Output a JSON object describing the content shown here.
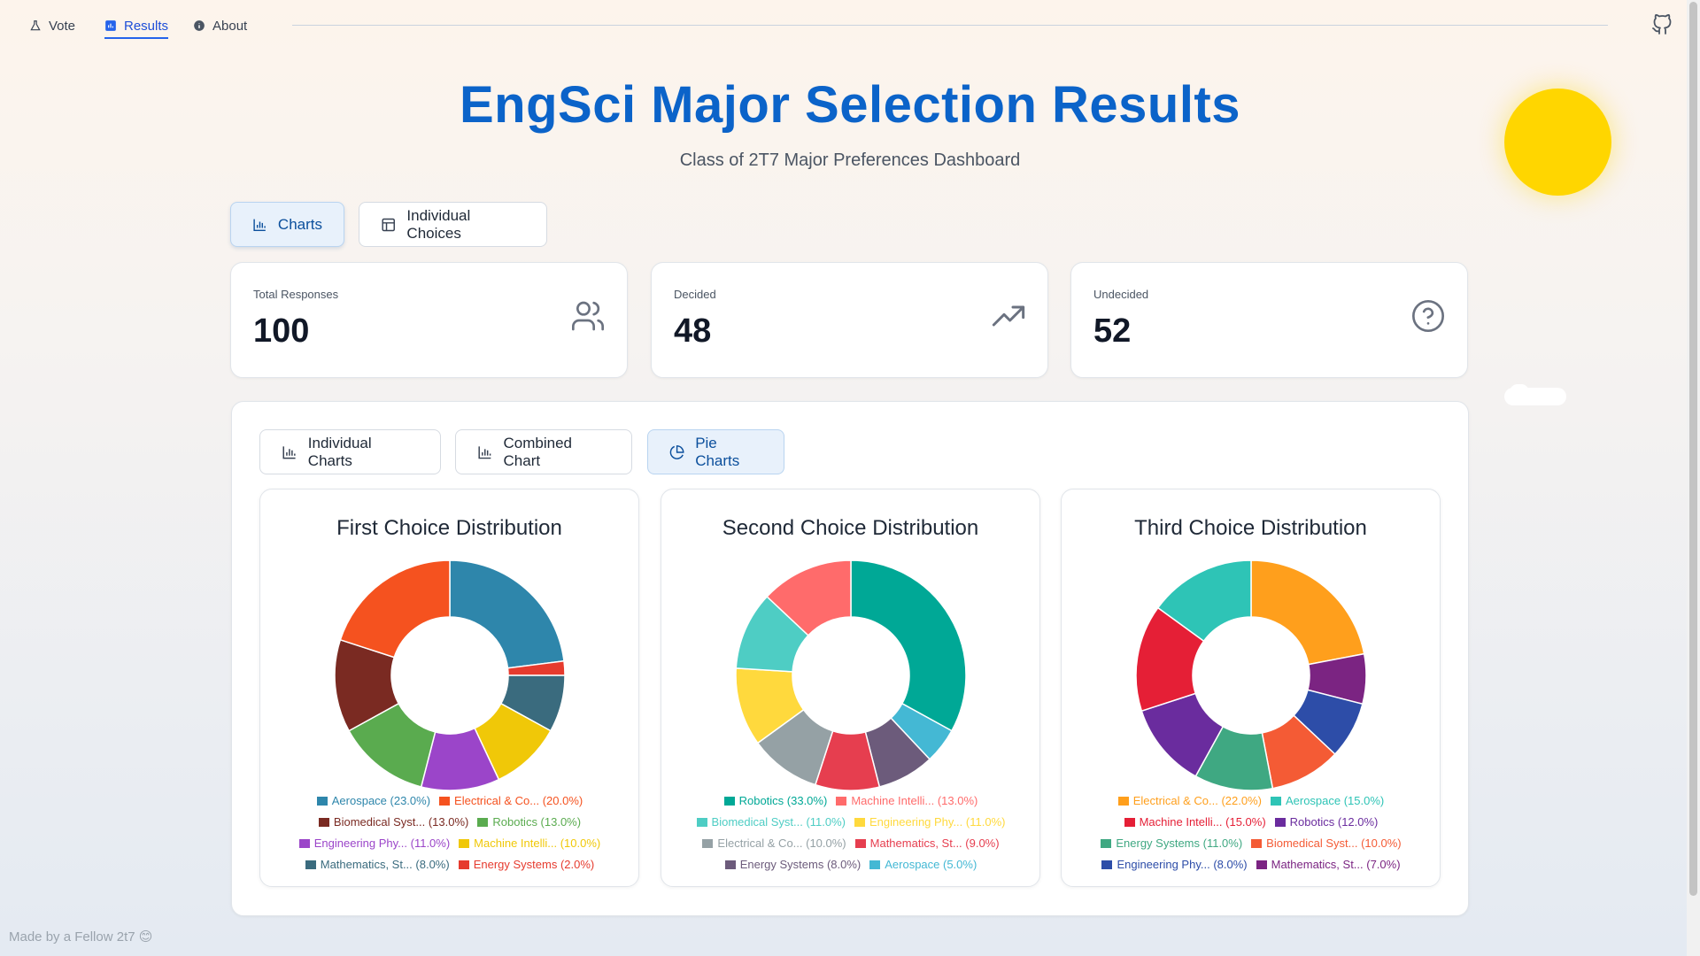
{
  "nav": {
    "items": [
      {
        "label": "Vote",
        "icon": "flask-icon"
      },
      {
        "label": "Results",
        "icon": "bar-chart-icon"
      },
      {
        "label": "About",
        "icon": "info-icon"
      }
    ],
    "github_icon": "github-icon"
  },
  "header": {
    "title": "EngSci Major Selection Results",
    "subtitle": "Class of 2T7 Major Preferences Dashboard"
  },
  "view_tabs": [
    {
      "label": "Charts",
      "icon": "bar-chart-icon",
      "active": true
    },
    {
      "label": "Individual Choices",
      "icon": "table-icon",
      "active": false
    }
  ],
  "stats": [
    {
      "label": "Total Responses",
      "value": "100",
      "icon": "users-icon"
    },
    {
      "label": "Decided",
      "value": "48",
      "icon": "trending-up-icon"
    },
    {
      "label": "Undecided",
      "value": "52",
      "icon": "help-circle-icon"
    }
  ],
  "chart_tabs": [
    {
      "label": "Individual Charts",
      "icon": "bar-chart-icon",
      "active": false
    },
    {
      "label": "Combined Chart",
      "icon": "bar-chart-icon",
      "active": false
    },
    {
      "label": "Pie Charts",
      "icon": "pie-chart-icon",
      "active": true
    }
  ],
  "chart_data": [
    {
      "type": "pie",
      "donut": true,
      "title": "First Choice Distribution",
      "slices": [
        {
          "label": "Aerospace (23.0%)",
          "value": 23,
          "color": "#2e86ab"
        },
        {
          "label": "Energy Systems (2.0%)",
          "value": 2,
          "color": "#e63b2e"
        },
        {
          "label": "Mathematics, St... (8.0%)",
          "value": 8,
          "color": "#3a6b7e"
        },
        {
          "label": "Machine Intelli... (10.0%)",
          "value": 10,
          "color": "#f0c808"
        },
        {
          "label": "Engineering Phy... (11.0%)",
          "value": 11,
          "color": "#9b45c9"
        },
        {
          "label": "Robotics (13.0%)",
          "value": 13,
          "color": "#5aab4f"
        },
        {
          "label": "Biomedical Syst... (13.0%)",
          "value": 13,
          "color": "#7a2a22"
        },
        {
          "label": "Electrical & Co... (20.0%)",
          "value": 20,
          "color": "#f5521f"
        }
      ],
      "legend_order": [
        0,
        7,
        6,
        5,
        4,
        3,
        2,
        1
      ]
    },
    {
      "type": "pie",
      "donut": true,
      "title": "Second Choice Distribution",
      "slices": [
        {
          "label": "Robotics (33.0%)",
          "value": 33,
          "color": "#00a896"
        },
        {
          "label": "Aerospace (5.0%)",
          "value": 5,
          "color": "#44b8d4"
        },
        {
          "label": "Energy Systems (8.0%)",
          "value": 8,
          "color": "#6c5b7b"
        },
        {
          "label": "Mathematics, St... (9.0%)",
          "value": 9,
          "color": "#e63e4f"
        },
        {
          "label": "Electrical & Co... (10.0%)",
          "value": 10,
          "color": "#95a1a5"
        },
        {
          "label": "Engineering Phy... (11.0%)",
          "value": 11,
          "color": "#ffd93d"
        },
        {
          "label": "Biomedical Syst... (11.0%)",
          "value": 11,
          "color": "#4ecdc4"
        },
        {
          "label": "Machine Intelli... (13.0%)",
          "value": 13,
          "color": "#ff6b6b"
        }
      ],
      "legend_order": [
        0,
        7,
        6,
        5,
        4,
        3,
        2,
        1
      ]
    },
    {
      "type": "pie",
      "donut": true,
      "title": "Third Choice Distribution",
      "slices": [
        {
          "label": "Electrical & Co... (22.0%)",
          "value": 22,
          "color": "#ff9f1c"
        },
        {
          "label": "Mathematics, St... (7.0%)",
          "value": 7,
          "color": "#7b2482"
        },
        {
          "label": "Engineering Phy... (8.0%)",
          "value": 8,
          "color": "#2d4da8"
        },
        {
          "label": "Biomedical Syst... (10.0%)",
          "value": 10,
          "color": "#f45b35"
        },
        {
          "label": "Energy Systems (11.0%)",
          "value": 11,
          "color": "#3fa882"
        },
        {
          "label": "Robotics (12.0%)",
          "value": 12,
          "color": "#6a2c9e"
        },
        {
          "label": "Machine Intelli... (15.0%)",
          "value": 15,
          "color": "#e51f36"
        },
        {
          "label": "Aerospace (15.0%)",
          "value": 15,
          "color": "#2ec4b6"
        }
      ],
      "legend_order": [
        0,
        7,
        6,
        5,
        4,
        3,
        2,
        1
      ]
    }
  ],
  "footer": {
    "text": "Made by a Fellow 2t7 😊"
  }
}
